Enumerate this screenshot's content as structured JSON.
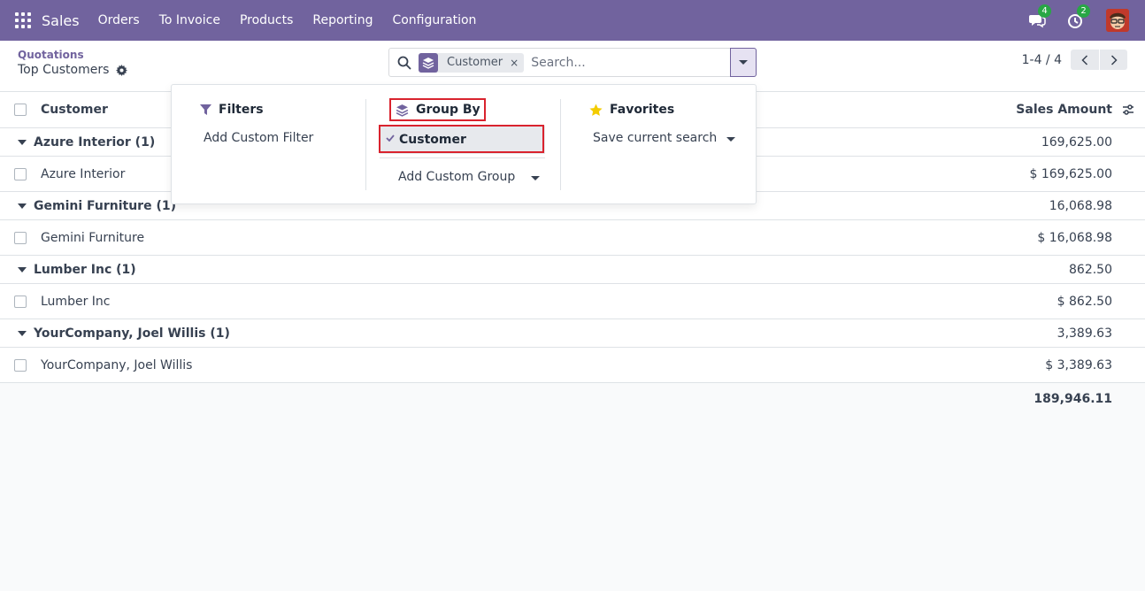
{
  "navbar": {
    "brand": "Sales",
    "menu": [
      "Orders",
      "To Invoice",
      "Products",
      "Reporting",
      "Configuration"
    ],
    "messages_count": "4",
    "activities_count": "2"
  },
  "breadcrumb": {
    "parent": "Quotations",
    "current": "Top Customers"
  },
  "search": {
    "facet_label": "Customer",
    "facet_remove": "×",
    "placeholder": "Search..."
  },
  "pager": {
    "value": "1-4 / 4"
  },
  "table": {
    "header": {
      "name": "Customer",
      "amount": "Sales Amount"
    },
    "groups": [
      {
        "label": "Azure Interior (1)",
        "amount": "169,625.00",
        "record": {
          "name": "Azure Interior",
          "amount": "$ 169,625.00"
        }
      },
      {
        "label": "Gemini Furniture (1)",
        "amount": "16,068.98",
        "record": {
          "name": "Gemini Furniture",
          "amount": "$ 16,068.98"
        }
      },
      {
        "label": "Lumber Inc (1)",
        "amount": "862.50",
        "record": {
          "name": "Lumber Inc",
          "amount": "$ 862.50"
        }
      },
      {
        "label": "YourCompany, Joel Willis (1)",
        "amount": "3,389.63",
        "record": {
          "name": "YourCompany, Joel Willis",
          "amount": "$ 3,389.63"
        }
      }
    ],
    "total": "189,946.11"
  },
  "dropdown": {
    "filters": {
      "title": "Filters",
      "add_custom": "Add Custom Filter"
    },
    "group_by": {
      "title": "Group By",
      "selected": "Customer",
      "add_custom": "Add Custom Group"
    },
    "favorites": {
      "title": "Favorites",
      "save": "Save current search"
    }
  },
  "colors": {
    "brand": "#71639e",
    "highlight": "#d9232e",
    "star": "#f3cc00"
  }
}
